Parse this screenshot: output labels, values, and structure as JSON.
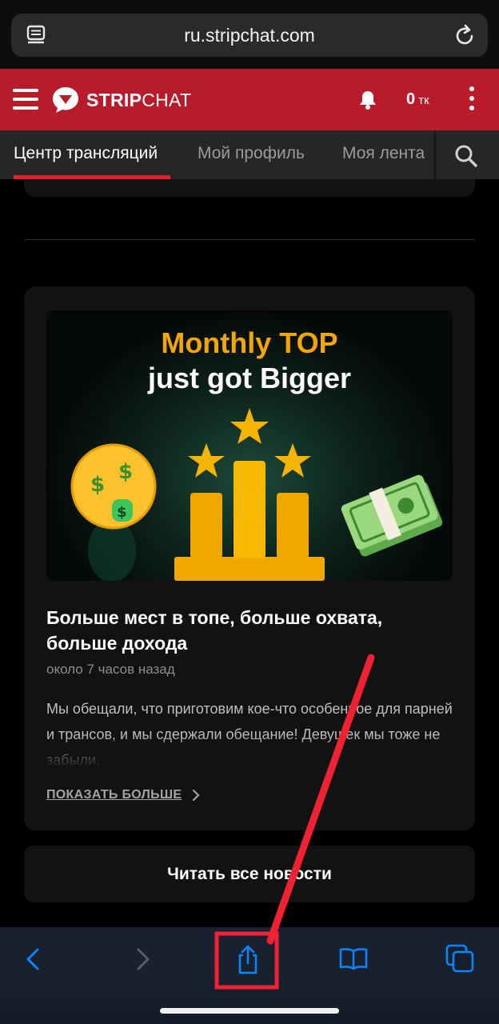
{
  "browser": {
    "url": "ru.stripchat.com",
    "reader_icon": "reader-view-icon",
    "reload_icon": "reload-icon"
  },
  "header": {
    "brand_bold": "STRIP",
    "brand_light": "CHAT",
    "tokens_value": "0",
    "tokens_unit": "тк",
    "accent_color": "#b81c2b"
  },
  "tabs": [
    {
      "label": "Центр трансляций",
      "active": true
    },
    {
      "label": "Мой профиль",
      "active": false
    },
    {
      "label": "Моя лента",
      "active": false
    }
  ],
  "news": {
    "banner_line1": "Monthly TOP",
    "banner_line2": "just got Bigger",
    "title": "Больше мест в топе, больше охвата, больше дохода",
    "time": "около 7 часов назад",
    "body": "Мы обещали, что приготовим кое-что особенное для парней и трансов, и мы сдержали обещание! Девушек мы тоже не забыли.",
    "show_more": "ПОКАЗАТЬ БОЛЬШЕ"
  },
  "read_all": "Читать все новости",
  "toolbar": {
    "items": [
      "back-icon",
      "forward-icon",
      "share-icon",
      "bookmarks-icon",
      "tabs-icon"
    ],
    "tint": "#0a84ff"
  },
  "annotation": {
    "color": "#ee2233"
  }
}
